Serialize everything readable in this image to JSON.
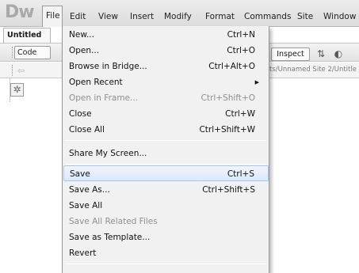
{
  "app": {
    "logo": "Dw"
  },
  "menubar": {
    "items": [
      {
        "label": "File",
        "active": true
      },
      {
        "label": "Edit"
      },
      {
        "label": "View"
      },
      {
        "label": "Insert"
      },
      {
        "label": "Modify"
      },
      {
        "label": "Format"
      },
      {
        "label": "Commands"
      },
      {
        "label": "Site"
      },
      {
        "label": "Window"
      }
    ]
  },
  "document": {
    "tab_title": "Untitled",
    "code_button": "Code",
    "inspect_button": "Inspect",
    "address": "ts/Unnamed Site 2/Untitle"
  },
  "file_menu": {
    "items": [
      {
        "label": "New...",
        "shortcut": "Ctrl+N"
      },
      {
        "label": "Open...",
        "shortcut": "Ctrl+O"
      },
      {
        "label": "Browse in Bridge...",
        "shortcut": "Ctrl+Alt+O"
      },
      {
        "label": "Open Recent",
        "submenu": true
      },
      {
        "label": "Open in Frame...",
        "shortcut": "Ctrl+Shift+O",
        "disabled": true
      },
      {
        "label": "Close",
        "shortcut": "Ctrl+W"
      },
      {
        "label": "Close All",
        "shortcut": "Ctrl+Shift+W"
      },
      {
        "label": "Share My Screen..."
      },
      {
        "label": "Save",
        "shortcut": "Ctrl+S",
        "highlighted": true
      },
      {
        "label": "Save As...",
        "shortcut": "Ctrl+Shift+S"
      },
      {
        "label": "Save All"
      },
      {
        "label": "Save All Related Files",
        "disabled": true
      },
      {
        "label": "Save as Template..."
      },
      {
        "label": "Revert"
      }
    ]
  },
  "colors": {
    "highlight_bg": "#dbe9fa",
    "highlight_border": "#a9c8ec",
    "disabled_text": "#8f8f8f"
  }
}
